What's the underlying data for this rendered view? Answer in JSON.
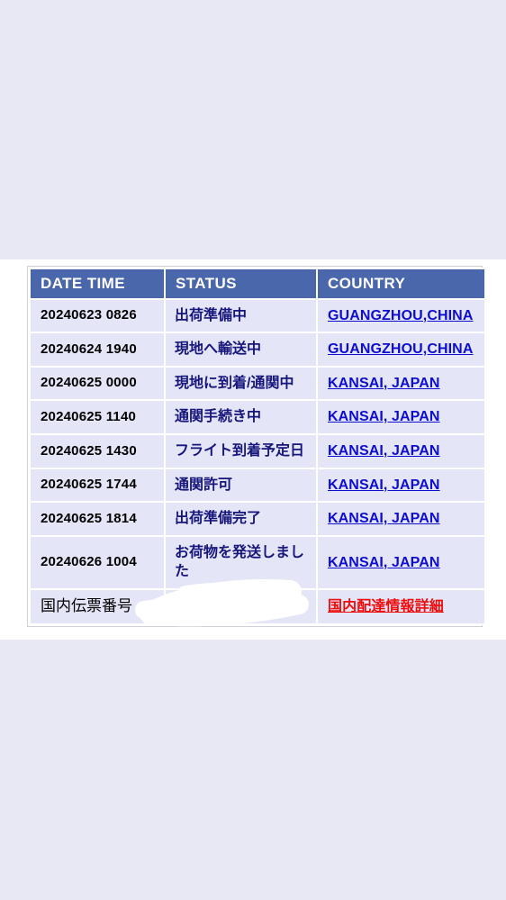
{
  "theme": {
    "page_background": "#e7e8f4",
    "card_background": "#ffffff",
    "header_background": "#4a67ab",
    "header_text": "#ffffff",
    "row_background": "#e4e5f6",
    "date_text": "#000000",
    "status_text": "#16167c",
    "link_color": "#0d0dd2",
    "alert_link_color": "#ee0b0b"
  },
  "table": {
    "name": "tracking-history-table",
    "columns": [
      {
        "key": "date",
        "label": "DATE  TIME"
      },
      {
        "key": "status",
        "label": "STATUS"
      },
      {
        "key": "country",
        "label": "COUNTRY"
      }
    ],
    "rows": [
      {
        "date": "20240623  0826",
        "status": "出荷準備中",
        "country": "GUANGZHOU,CHINA",
        "country_is_link": true
      },
      {
        "date": "20240624  1940",
        "status": "現地へ輸送中",
        "country": "GUANGZHOU,CHINA",
        "country_is_link": true
      },
      {
        "date": "20240625  0000",
        "status": "現地に到着/通関中",
        "country": "KANSAI, JAPAN",
        "country_is_link": true
      },
      {
        "date": "20240625  1140",
        "status": "通関手続き中",
        "country": "KANSAI, JAPAN",
        "country_is_link": true
      },
      {
        "date": "20240625  1430",
        "status": "フライト到着予定日",
        "country": "KANSAI, JAPAN",
        "country_is_link": true
      },
      {
        "date": "20240625  1744",
        "status": "通関許可",
        "country": "KANSAI, JAPAN",
        "country_is_link": true
      },
      {
        "date": "20240625  1814",
        "status": "出荷準備完了",
        "country": "KANSAI, JAPAN",
        "country_is_link": true
      },
      {
        "date": "20240626  1004",
        "status": "お荷物を発送しました",
        "country": "KANSAI, JAPAN",
        "country_is_link": true
      }
    ],
    "footer_row": {
      "label": "国内伝票番号",
      "value_redacted": true,
      "value_redaction_note": "white-scribble-mask",
      "link_label": "国内配達情報詳細",
      "link_color": "#ee0b0b"
    }
  }
}
